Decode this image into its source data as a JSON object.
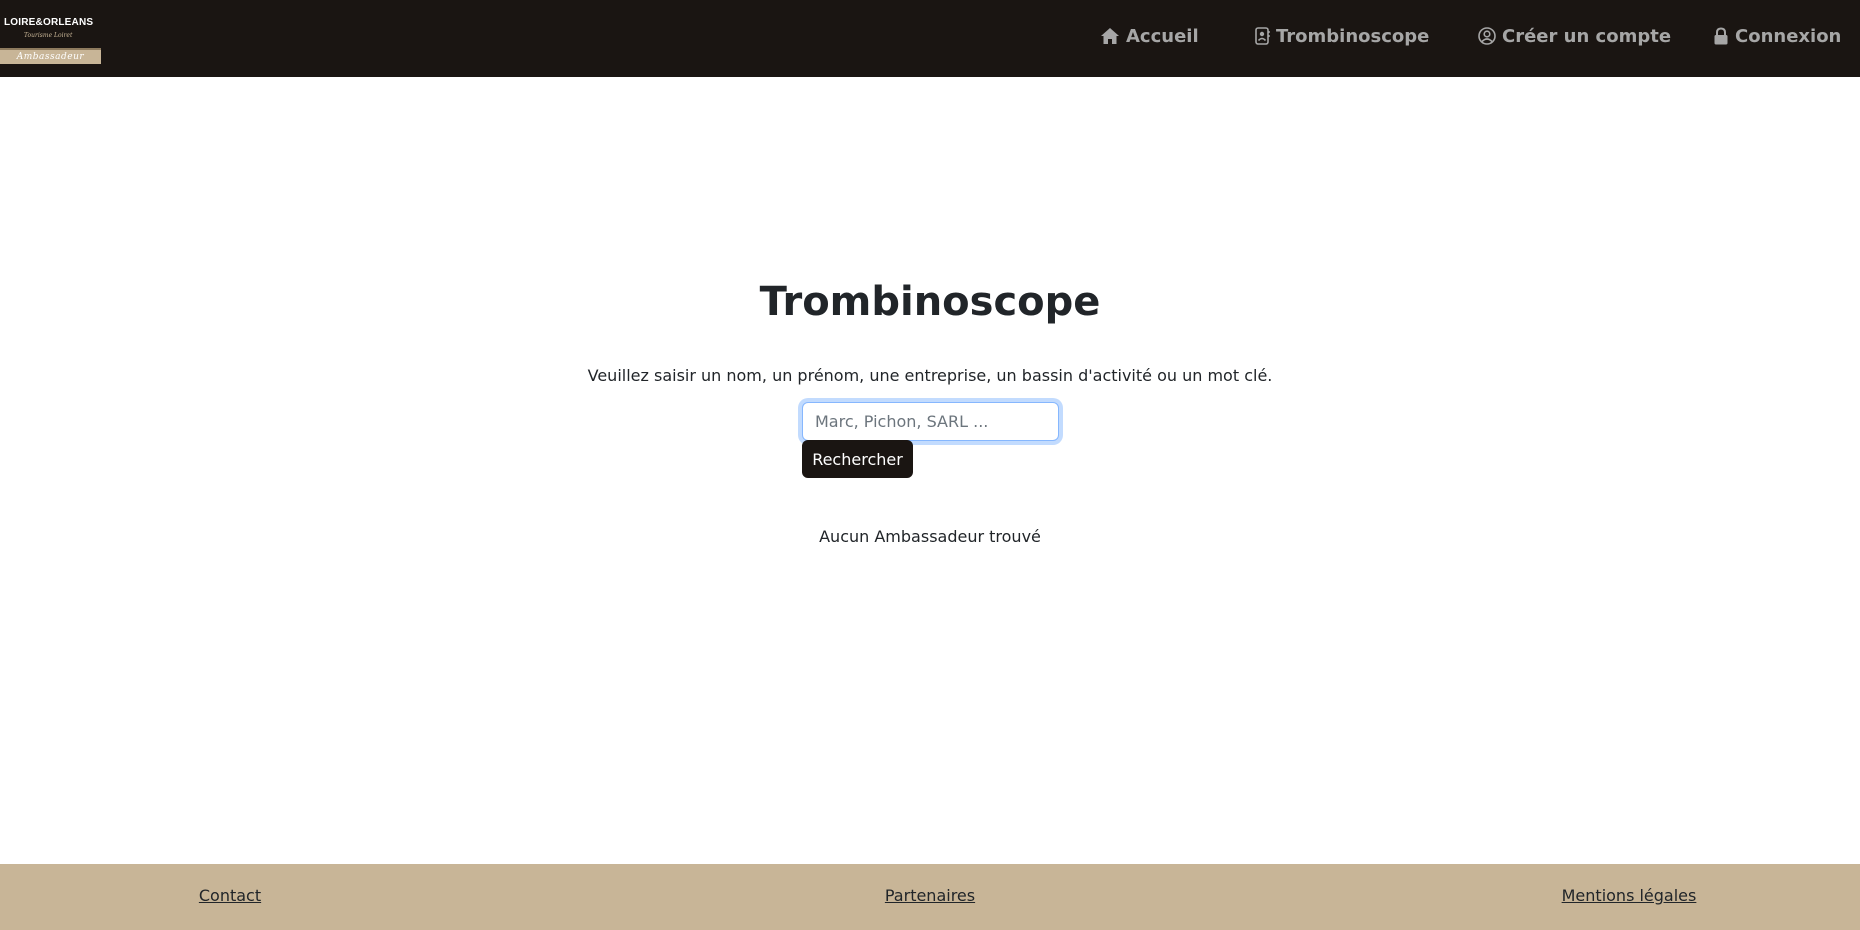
{
  "header": {
    "logo": {
      "line1": "LOIRE&ORLEANS",
      "line2": "Tourisme Loiret",
      "band": "Ambassadeur"
    },
    "nav": [
      {
        "label": "Accueil",
        "icon": "home-icon"
      },
      {
        "label": "Trombinoscope",
        "icon": "contact-card-icon"
      },
      {
        "label": "Créer un compte",
        "icon": "user-circle-icon"
      },
      {
        "label": "Connexion",
        "icon": "lock-icon"
      }
    ]
  },
  "main": {
    "title": "Trombinoscope",
    "instructions": "Veuillez saisir un nom, un prénom, une entreprise, un bassin d'activité ou un mot clé.",
    "search": {
      "placeholder": "Marc, Pichon, SARL ...",
      "value": "",
      "button_label": "Rechercher"
    },
    "no_results": "Aucun Ambassadeur trouvé"
  },
  "footer": {
    "links": [
      "Contact",
      "Partenaires",
      "Mentions légales"
    ]
  },
  "colors": {
    "navbar_bg": "#1a1512",
    "nav_text": "#a6a6a6",
    "accent_beige": "#c8b597",
    "button_bg": "#1a1512",
    "focus_ring": "#86b7fe"
  }
}
